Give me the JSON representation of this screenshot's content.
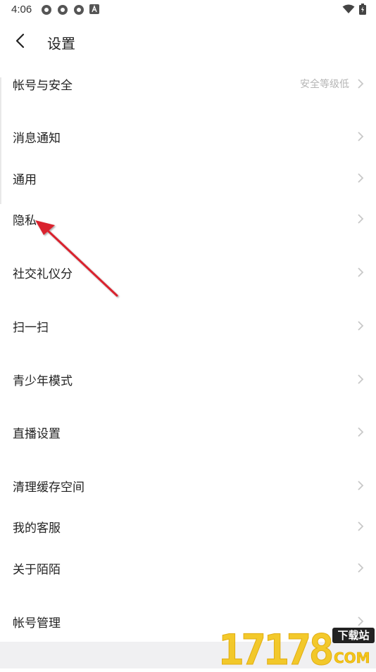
{
  "status_bar": {
    "time": "4:06"
  },
  "header": {
    "title": "设置"
  },
  "settings": [
    {
      "label": "帐号与安全",
      "value": "安全等级低"
    },
    {
      "label": "消息通知",
      "value": ""
    },
    {
      "label": "通用",
      "value": ""
    },
    {
      "label": "隐私",
      "value": ""
    },
    {
      "label": "社交礼仪分",
      "value": ""
    },
    {
      "label": "扫一扫",
      "value": ""
    },
    {
      "label": "青少年模式",
      "value": ""
    },
    {
      "label": "直播设置",
      "value": ""
    },
    {
      "label": "清理缓存空间",
      "value": ""
    },
    {
      "label": "我的客服",
      "value": ""
    },
    {
      "label": "关于陌陌",
      "value": ""
    },
    {
      "label": "帐号管理",
      "value": ""
    }
  ],
  "watermark": {
    "number": "17178",
    "badge": "下载站",
    "domain": "COM"
  },
  "colors": {
    "text": "#222222",
    "muted": "#b5b5b5",
    "chevron": "#c8c8c8",
    "arrow": "#d9232d",
    "watermark": "#f3c51a"
  }
}
